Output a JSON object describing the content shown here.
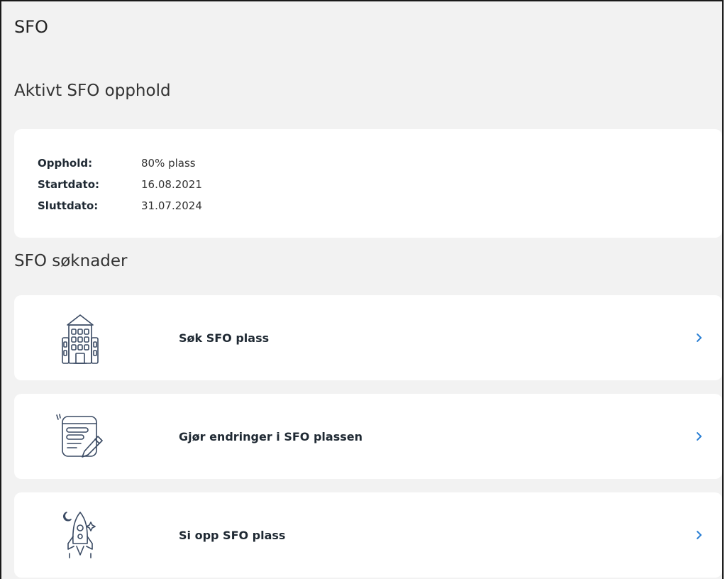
{
  "page": {
    "title": "SFO"
  },
  "active_stay": {
    "heading": "Aktivt SFO opphold",
    "rows": [
      {
        "label": "Opphold:",
        "value": "80% plass"
      },
      {
        "label": "Startdato:",
        "value": "16.08.2021"
      },
      {
        "label": "Sluttdato:",
        "value": "31.07.2024"
      }
    ]
  },
  "applications": {
    "heading": "SFO søknader",
    "items": [
      {
        "label": "Søk SFO plass",
        "icon": "school-building-icon"
      },
      {
        "label": "Gjør endringer i SFO plassen",
        "icon": "form-edit-icon"
      },
      {
        "label": "Si opp SFO plass",
        "icon": "rocket-icon"
      }
    ]
  },
  "colors": {
    "background": "#f2f2f2",
    "card": "#ffffff",
    "chevron": "#2a7fd4",
    "icon_stroke": "#3a4a63"
  }
}
